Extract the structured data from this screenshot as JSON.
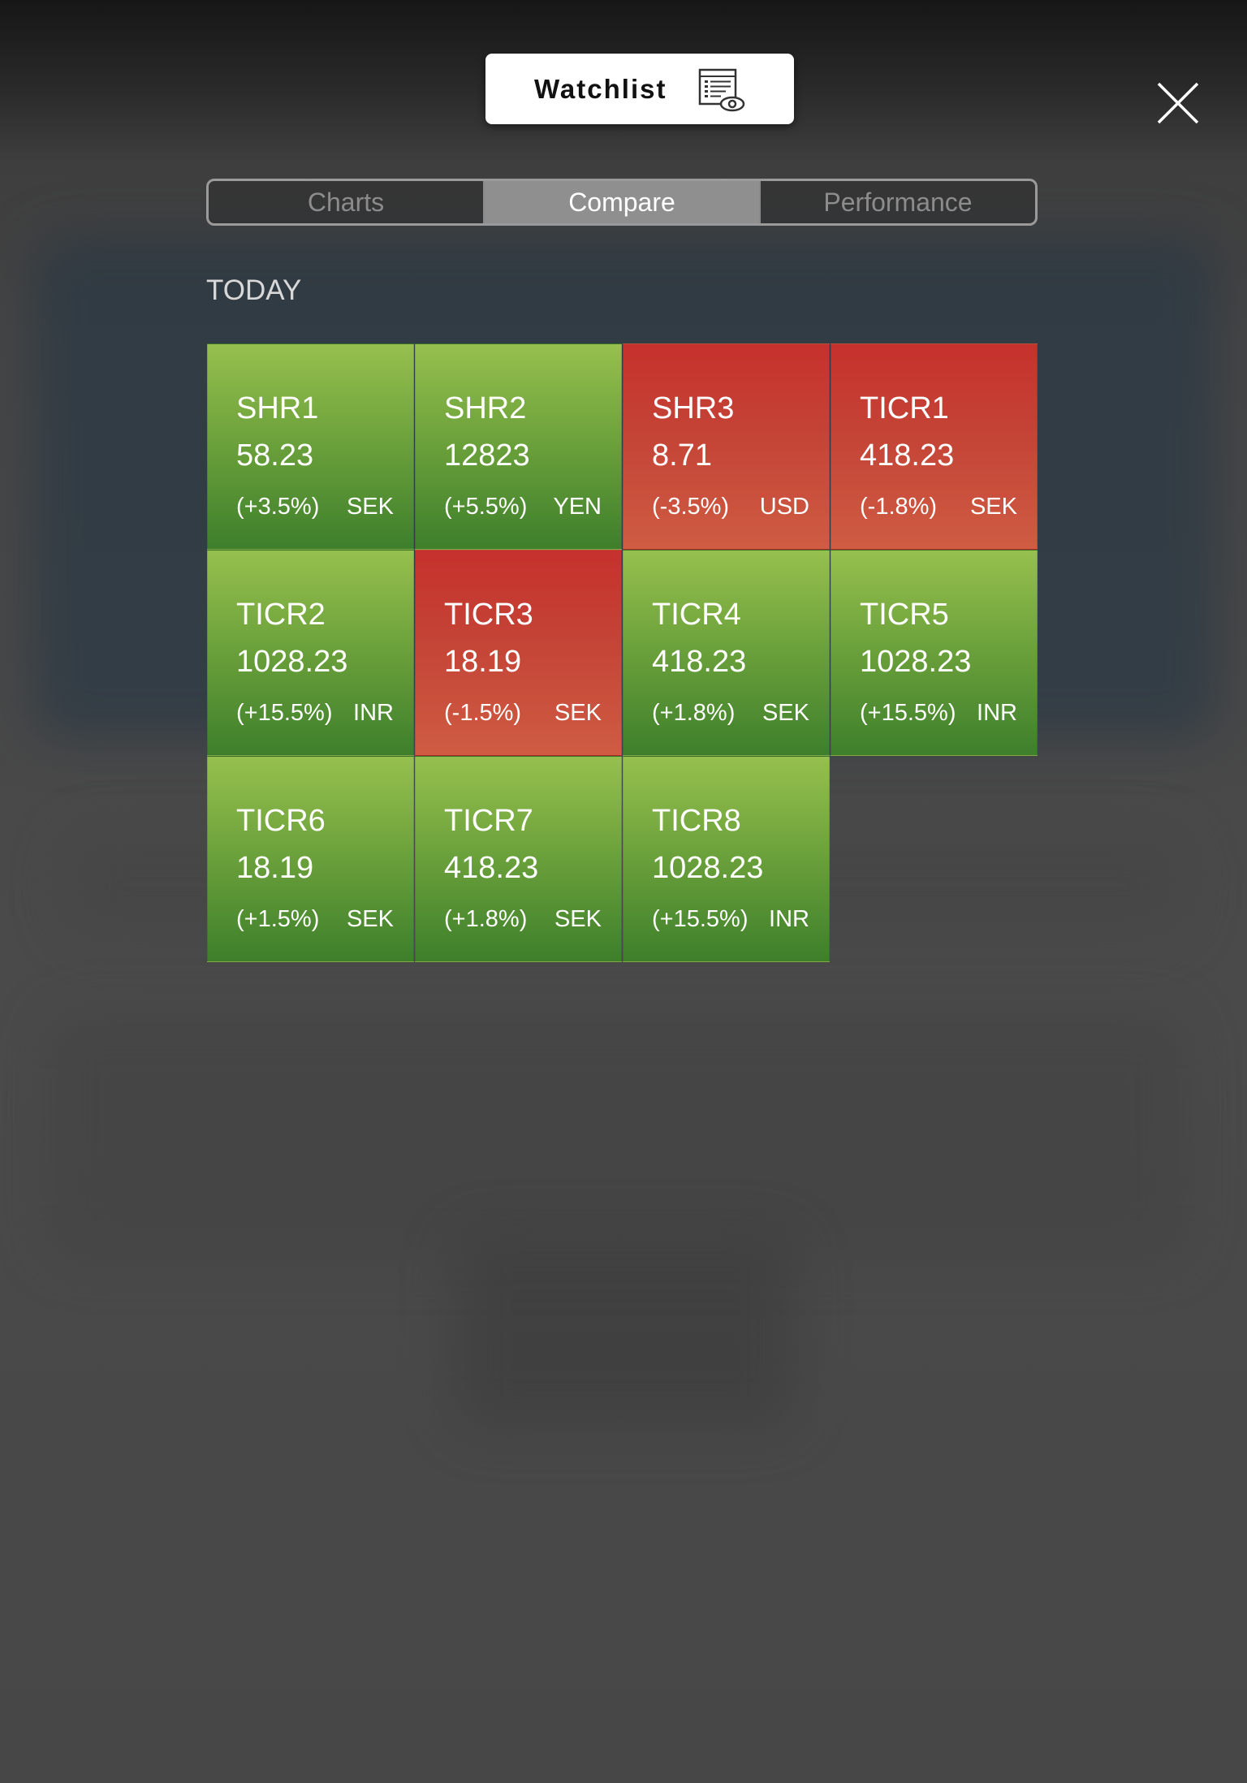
{
  "header": {
    "watchlist_label": "Watchlist",
    "watchlist_icon": "watchlist-eye-icon",
    "close_icon": "close-icon"
  },
  "tabs": [
    {
      "label": "Charts",
      "active": false
    },
    {
      "label": "Compare",
      "active": true
    },
    {
      "label": "Performance",
      "active": false
    }
  ],
  "section": {
    "label": "TODAY"
  },
  "colors": {
    "up": "#6ea33c",
    "down": "#c44436"
  },
  "tiles": [
    {
      "symbol": "SHR1",
      "price": "58.23",
      "change": "(+3.5%)",
      "currency": "SEK",
      "direction": "up"
    },
    {
      "symbol": "SHR2",
      "price": "12823",
      "change": "(+5.5%)",
      "currency": "YEN",
      "direction": "up"
    },
    {
      "symbol": "SHR3",
      "price": "8.71",
      "change": "(-3.5%)",
      "currency": "USD",
      "direction": "down"
    },
    {
      "symbol": "TICR1",
      "price": "418.23",
      "change": "(-1.8%)",
      "currency": "SEK",
      "direction": "down"
    },
    {
      "symbol": "TICR2",
      "price": "1028.23",
      "change": "(+15.5%)",
      "currency": "INR",
      "direction": "up"
    },
    {
      "symbol": "TICR3",
      "price": "18.19",
      "change": "(-1.5%)",
      "currency": "SEK",
      "direction": "down"
    },
    {
      "symbol": "TICR4",
      "price": "418.23",
      "change": "(+1.8%)",
      "currency": "SEK",
      "direction": "up"
    },
    {
      "symbol": "TICR5",
      "price": "1028.23",
      "change": "(+15.5%)",
      "currency": "INR",
      "direction": "up"
    },
    {
      "symbol": "TICR6",
      "price": "18.19",
      "change": "(+1.5%)",
      "currency": "SEK",
      "direction": "up"
    },
    {
      "symbol": "TICR7",
      "price": "418.23",
      "change": "(+1.8%)",
      "currency": "SEK",
      "direction": "up"
    },
    {
      "symbol": "TICR8",
      "price": "1028.23",
      "change": "(+15.5%)",
      "currency": "INR",
      "direction": "up"
    }
  ]
}
